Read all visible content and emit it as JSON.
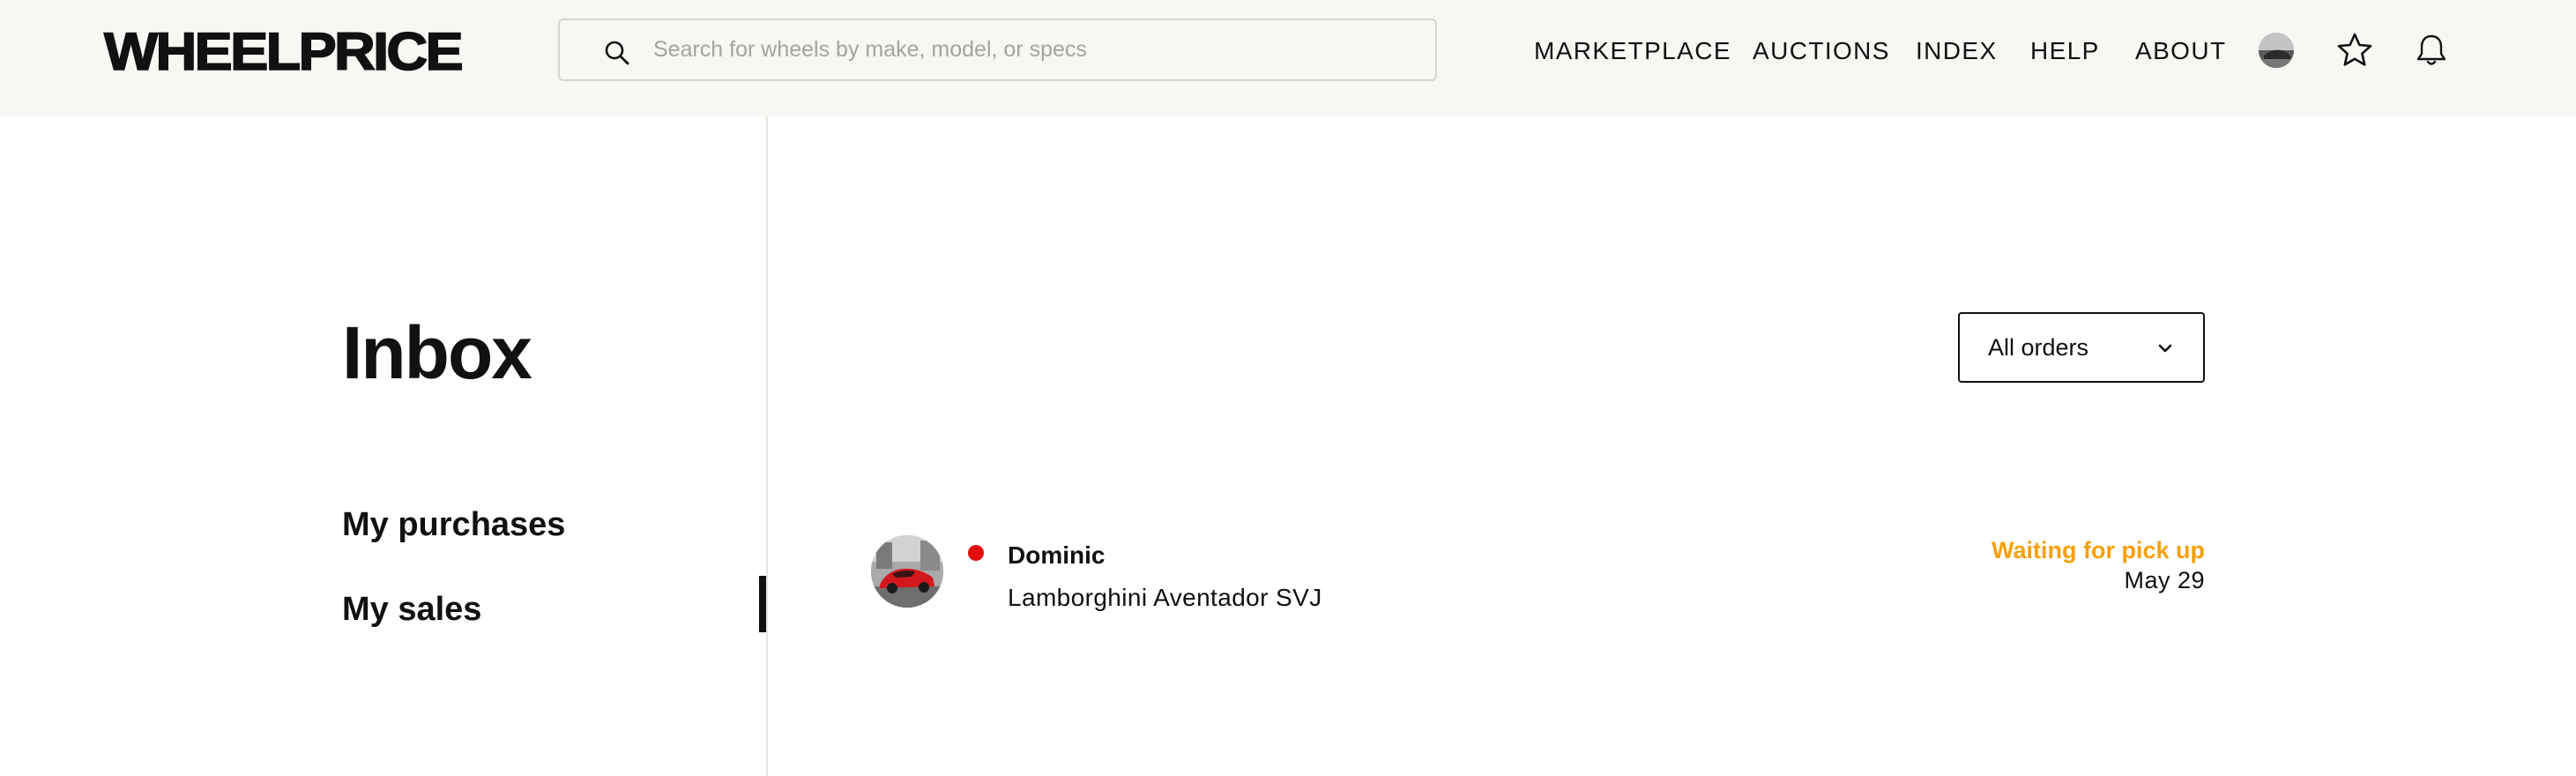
{
  "header": {
    "logo": "WHEELPRICE",
    "search": {
      "placeholder": "Search for wheels by make, model, or specs",
      "value": "",
      "icon": "search-icon"
    },
    "nav": [
      {
        "label": "MARKETPLACE"
      },
      {
        "label": "AUCTIONS"
      },
      {
        "label": "INDEX"
      },
      {
        "label": "HELP"
      },
      {
        "label": "ABOUT"
      }
    ],
    "icons": [
      "avatar",
      "star-icon",
      "bell-icon"
    ]
  },
  "sidebar": {
    "title": "Inbox",
    "items": [
      {
        "label": "My purchases",
        "active": false
      },
      {
        "label": "My sales",
        "active": true
      }
    ]
  },
  "main": {
    "filter": {
      "selected": "All orders",
      "icon": "chevron-down-icon"
    },
    "orders": [
      {
        "buyer": "Dominic",
        "item": "Lamborghini Aventador SVJ",
        "status": "Waiting for pick up",
        "date": "May 29",
        "unread": true
      }
    ]
  },
  "colors": {
    "header_bg": "#f8f7f4",
    "text": "#111111",
    "status_pending": "#f5a10e",
    "unread_dot": "#e30d0d",
    "divider": "#e6e5e2",
    "placeholder": "#a5a3a0"
  }
}
